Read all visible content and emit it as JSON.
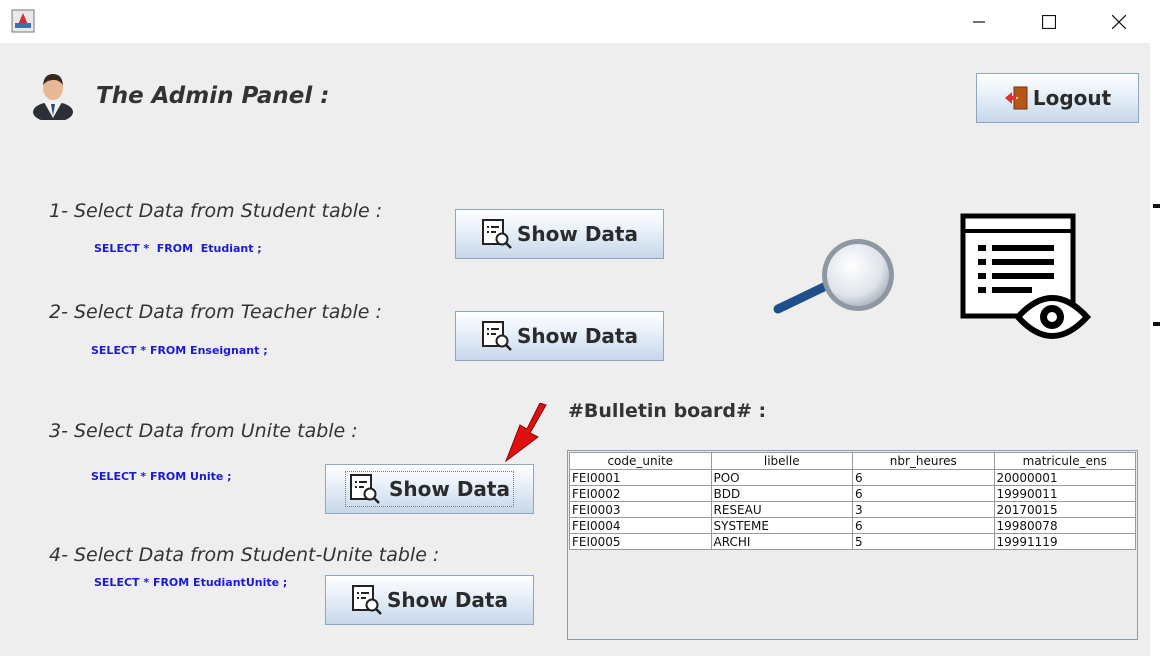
{
  "header": {
    "title": "The Admin Panel  :",
    "logout_label": "Logout"
  },
  "sections": [
    {
      "label": "1- Select Data from Student table :",
      "query": "SELECT *  FROM  Etudiant ;",
      "button_label": "Show Data"
    },
    {
      "label": "2- Select Data from Teacher table :",
      "query": "SELECT * FROM Enseignant ;",
      "button_label": "Show Data"
    },
    {
      "label": "3- Select Data from Unite table :",
      "query": "SELECT * FROM Unite ;",
      "button_label": "Show Data"
    },
    {
      "label": "4- Select Data from Student-Unite table :",
      "query": "SELECT * FROM EtudiantUnite ;",
      "button_label": "Show Data"
    }
  ],
  "bulletin": {
    "title": "#Bulletin board# :",
    "columns": [
      "code_unite",
      "libelle",
      "nbr_heures",
      "matricule_ens"
    ],
    "rows": [
      [
        "FEI0001",
        "POO",
        "6",
        "20000001"
      ],
      [
        "FEI0002",
        "BDD",
        "6",
        "19990011"
      ],
      [
        "FEI0003",
        "RESEAU",
        "3",
        "20170015"
      ],
      [
        "FEI0004",
        "SYSTEME",
        "6",
        "19980078"
      ],
      [
        "FEI0005",
        "ARCHI",
        "5",
        "19991119"
      ]
    ]
  },
  "icons": {
    "app": "java-app-icon",
    "avatar": "admin-user-icon",
    "logout": "door-exit-icon",
    "show": "search-document-icon",
    "magnifier": "magnifier-icon",
    "view_document": "document-eye-icon",
    "pointer": "red-arrow-icon"
  },
  "colors": {
    "sql_text": "#1b1bd6",
    "window_bg": "#eeeeee",
    "accent_arrow": "#e01010"
  }
}
